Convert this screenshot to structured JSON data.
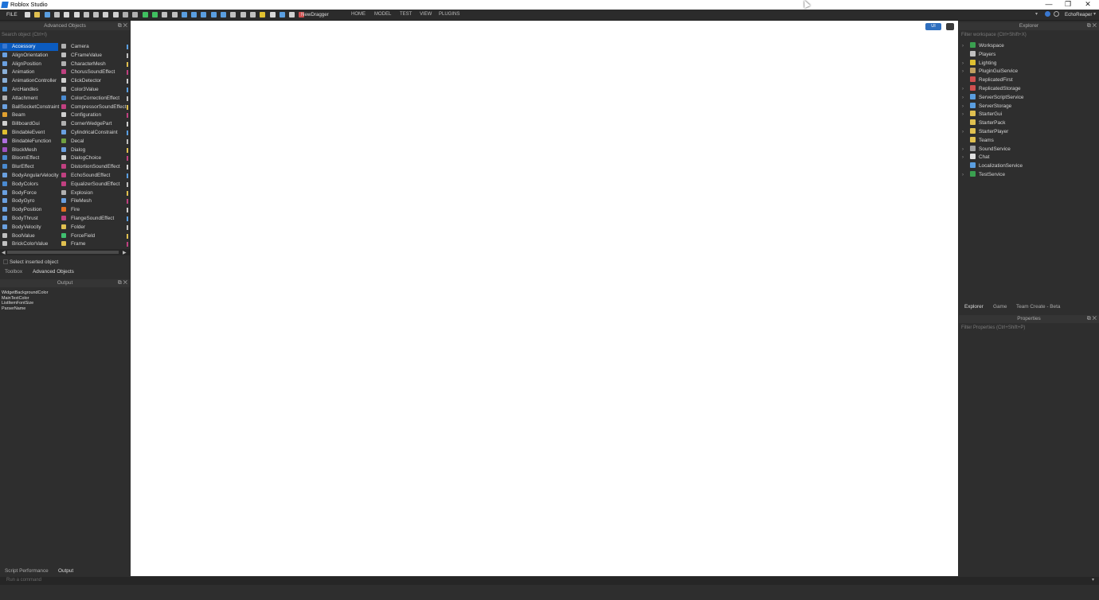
{
  "window": {
    "title": "Roblox Studio",
    "minimize": "—",
    "restore": "❐",
    "close": "✕"
  },
  "ribbon": {
    "file_label": "FILE",
    "dragger_label": "NewDragger",
    "menus": [
      "HOME",
      "MODEL",
      "TEST",
      "VIEW",
      "PLUGINS"
    ],
    "user": "EchoReaper"
  },
  "objects_panel": {
    "title": "Advanced Objects",
    "search_placeholder": "Search object (Ctrl+I)",
    "col1": [
      {
        "label": "Accessory",
        "icon": "accessory-icon",
        "color": "#3a78d0",
        "selected": true
      },
      {
        "label": "AlignOrientation",
        "icon": "align-orientation-icon",
        "color": "#6aa0e0"
      },
      {
        "label": "AlignPosition",
        "icon": "align-position-icon",
        "color": "#6aa0e0"
      },
      {
        "label": "Animation",
        "icon": "animation-icon",
        "color": "#8ab0d8"
      },
      {
        "label": "AnimationController",
        "icon": "animation-controller-icon",
        "color": "#8ab0d8"
      },
      {
        "label": "ArcHandles",
        "icon": "arc-handles-icon",
        "color": "#5a9ee0"
      },
      {
        "label": "Attachment",
        "icon": "attachment-icon",
        "color": "#b0b0b0"
      },
      {
        "label": "BallSocketConstraint",
        "icon": "ballsocket-icon",
        "color": "#6aa0e0"
      },
      {
        "label": "Beam",
        "icon": "beam-icon",
        "color": "#e0a030"
      },
      {
        "label": "BillboardGui",
        "icon": "billboardgui-icon",
        "color": "#d0d0d0"
      },
      {
        "label": "BindableEvent",
        "icon": "bindable-event-icon",
        "color": "#e0c030"
      },
      {
        "label": "BindableFunction",
        "icon": "bindable-function-icon",
        "color": "#b070e0"
      },
      {
        "label": "BlockMesh",
        "icon": "blockmesh-icon",
        "color": "#a050c0"
      },
      {
        "label": "BloomEffect",
        "icon": "bloom-effect-icon",
        "color": "#4a8ad0"
      },
      {
        "label": "BlurEffect",
        "icon": "blur-effect-icon",
        "color": "#4a8ad0"
      },
      {
        "label": "BodyAngularVelocity",
        "icon": "body-angular-velocity-icon",
        "color": "#6aa0e0"
      },
      {
        "label": "BodyColors",
        "icon": "body-colors-icon",
        "color": "#4a8ad0"
      },
      {
        "label": "BodyForce",
        "icon": "body-force-icon",
        "color": "#6aa0e0"
      },
      {
        "label": "BodyGyro",
        "icon": "body-gyro-icon",
        "color": "#6aa0e0"
      },
      {
        "label": "BodyPosition",
        "icon": "body-position-icon",
        "color": "#6aa0e0"
      },
      {
        "label": "BodyThrust",
        "icon": "body-thrust-icon",
        "color": "#6aa0e0"
      },
      {
        "label": "BodyVelocity",
        "icon": "body-velocity-icon",
        "color": "#6aa0e0"
      },
      {
        "label": "BoolValue",
        "icon": "bool-value-icon",
        "color": "#c0c0c0"
      },
      {
        "label": "BrickColorValue",
        "icon": "brick-color-value-icon",
        "color": "#c0c0c0"
      }
    ],
    "col2": [
      {
        "label": "Camera",
        "icon": "camera-icon",
        "color": "#b0b0b0"
      },
      {
        "label": "CFrameValue",
        "icon": "cframe-value-icon",
        "color": "#c0c0c0"
      },
      {
        "label": "CharacterMesh",
        "icon": "character-mesh-icon",
        "color": "#b0b0b0"
      },
      {
        "label": "ChorusSoundEffect",
        "icon": "chorus-sound-effect-icon",
        "color": "#c04080"
      },
      {
        "label": "ClickDetector",
        "icon": "click-detector-icon",
        "color": "#d0d0d0"
      },
      {
        "label": "Color3Value",
        "icon": "color3-value-icon",
        "color": "#c0c0c0"
      },
      {
        "label": "ColorCorrectionEffect",
        "icon": "color-correction-effect-icon",
        "color": "#4a8ad0"
      },
      {
        "label": "CompressorSoundEffect",
        "icon": "compressor-sound-effect-icon",
        "color": "#c04080"
      },
      {
        "label": "Configuration",
        "icon": "configuration-icon",
        "color": "#d0d0d0"
      },
      {
        "label": "CornerWedgePart",
        "icon": "corner-wedge-part-icon",
        "color": "#b0b0b0"
      },
      {
        "label": "CylindricalConstraint",
        "icon": "cylindrical-constraint-icon",
        "color": "#6aa0e0"
      },
      {
        "label": "Decal",
        "icon": "decal-icon",
        "color": "#70a040"
      },
      {
        "label": "Dialog",
        "icon": "dialog-icon",
        "color": "#6aa0e0"
      },
      {
        "label": "DialogChoice",
        "icon": "dialog-choice-icon",
        "color": "#d0d0d0"
      },
      {
        "label": "DistortionSoundEffect",
        "icon": "distortion-sound-effect-icon",
        "color": "#c04080"
      },
      {
        "label": "EchoSoundEffect",
        "icon": "echo-sound-effect-icon",
        "color": "#c04080"
      },
      {
        "label": "EqualizerSoundEffect",
        "icon": "equalizer-sound-effect-icon",
        "color": "#c04080"
      },
      {
        "label": "Explosion",
        "icon": "explosion-icon",
        "color": "#b0b0b0"
      },
      {
        "label": "FileMesh",
        "icon": "file-mesh-icon",
        "color": "#6aa0e0"
      },
      {
        "label": "Fire",
        "icon": "fire-icon",
        "color": "#e07020"
      },
      {
        "label": "FlangeSoundEffect",
        "icon": "flange-sound-effect-icon",
        "color": "#c04080"
      },
      {
        "label": "Folder",
        "icon": "folder-icon",
        "color": "#e0c050"
      },
      {
        "label": "ForceField",
        "icon": "force-field-icon",
        "color": "#40c070"
      },
      {
        "label": "Frame",
        "icon": "frame-icon",
        "color": "#e0c050"
      }
    ],
    "select_inserted_label": "Select inserted object",
    "tabs": [
      "Toolbox",
      "Advanced Objects"
    ]
  },
  "output_panel": {
    "title": "Output",
    "lines": [
      "WidgetBackgroundColor",
      "MainTextColor",
      "ListItemFontSize",
      "ParserName"
    ],
    "tabs": [
      "Script Performance",
      "Output"
    ]
  },
  "command_bar": {
    "placeholder": "Run a command"
  },
  "explorer": {
    "title": "Explorer",
    "filter_placeholder": "Filter workspace (Ctrl+Shift+X)",
    "items": [
      {
        "label": "Workspace",
        "expandable": true,
        "icon": "workspace-icon",
        "color": "#3aa050"
      },
      {
        "label": "Players",
        "expandable": false,
        "icon": "players-icon",
        "color": "#c0c0c0"
      },
      {
        "label": "Lighting",
        "expandable": true,
        "icon": "lighting-icon",
        "color": "#e0c030"
      },
      {
        "label": "PluginGuiService",
        "expandable": true,
        "icon": "plugin-gui-service-icon",
        "color": "#c0a060"
      },
      {
        "label": "ReplicatedFirst",
        "expandable": false,
        "icon": "replicated-first-icon",
        "color": "#d05050"
      },
      {
        "label": "ReplicatedStorage",
        "expandable": true,
        "icon": "replicated-storage-icon",
        "color": "#d05050"
      },
      {
        "label": "ServerScriptService",
        "expandable": true,
        "icon": "server-script-service-icon",
        "color": "#5a9ee0"
      },
      {
        "label": "ServerStorage",
        "expandable": true,
        "icon": "server-storage-icon",
        "color": "#5a9ee0"
      },
      {
        "label": "StarterGui",
        "expandable": true,
        "icon": "starter-gui-icon",
        "color": "#e0c050"
      },
      {
        "label": "StarterPack",
        "expandable": false,
        "icon": "starter-pack-icon",
        "color": "#e0c050"
      },
      {
        "label": "StarterPlayer",
        "expandable": true,
        "icon": "starter-player-icon",
        "color": "#e0c050"
      },
      {
        "label": "Teams",
        "expandable": false,
        "icon": "teams-icon",
        "color": "#e0c050"
      },
      {
        "label": "SoundService",
        "expandable": true,
        "icon": "sound-service-icon",
        "color": "#a0a0a0"
      },
      {
        "label": "Chat",
        "expandable": true,
        "icon": "chat-icon",
        "color": "#e0e0e0"
      },
      {
        "label": "LocalizationService",
        "expandable": false,
        "icon": "localization-service-icon",
        "color": "#5a9ee0"
      },
      {
        "label": "TestService",
        "expandable": true,
        "icon": "test-service-icon",
        "color": "#3aa050"
      }
    ],
    "tabs": [
      "Explorer",
      "Game",
      "Team Create - Beta"
    ]
  },
  "properties": {
    "title": "Properties",
    "filter_placeholder": "Filter Properties (Ctrl+Shift+P)"
  },
  "viewport_buttons": {
    "ui_toggle_label": "UI"
  }
}
